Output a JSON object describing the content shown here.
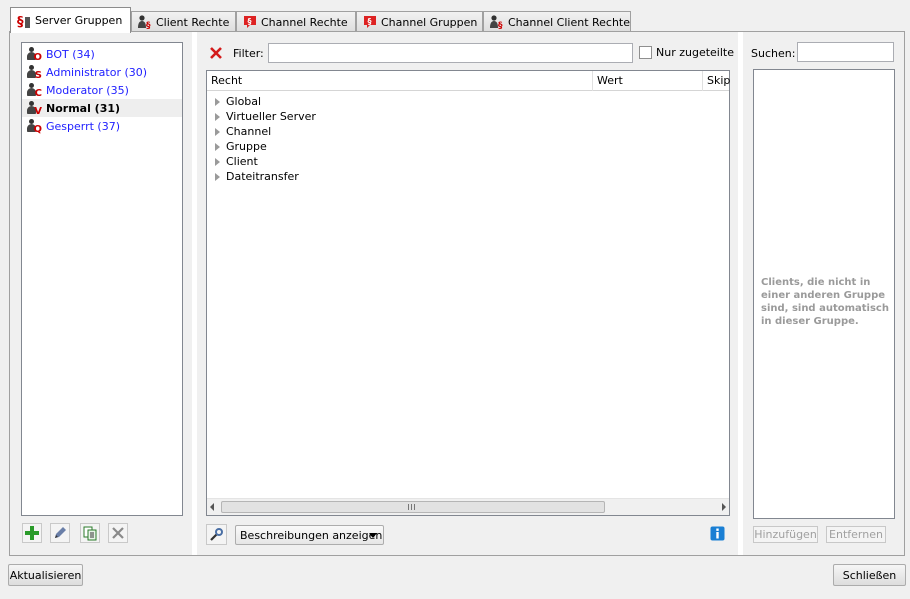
{
  "tabs": [
    {
      "label": "Server Gruppen",
      "icon": "server-group-icon",
      "active": true
    },
    {
      "label": "Client Rechte",
      "icon": "client-permission-icon",
      "active": false
    },
    {
      "label": "Channel Rechte",
      "icon": "channel-permission-icon",
      "active": false
    },
    {
      "label": "Channel Gruppen",
      "icon": "channel-group-icon",
      "active": false
    },
    {
      "label": "Channel Client Rechte",
      "icon": "channel-client-permission-icon",
      "active": false
    }
  ],
  "groups": [
    {
      "label": "BOT (34)",
      "badge": "O",
      "selected": false
    },
    {
      "label": "Administrator (30)",
      "badge": "S",
      "selected": false
    },
    {
      "label": "Moderator (35)",
      "badge": "C",
      "selected": false
    },
    {
      "label": "Normal (31)",
      "badge": "V",
      "selected": true
    },
    {
      "label": "Gesperrt (37)",
      "badge": "Q",
      "selected": false
    }
  ],
  "group_tools": [
    "add-group-icon",
    "rename-group-icon",
    "copy-group-icon",
    "delete-group-icon"
  ],
  "filter": {
    "label": "Filter:",
    "value": "",
    "only_assigned_label": "Nur zugeteilte",
    "only_assigned_checked": false
  },
  "tree": {
    "columns": [
      "Recht",
      "Wert",
      "Skip"
    ],
    "items": [
      "Global",
      "Virtueller Server",
      "Channel",
      "Gruppe",
      "Client",
      "Dateitransfer"
    ]
  },
  "descriptions_dropdown": "Beschreibungen anzeigen",
  "search": {
    "label": "Suchen:",
    "value": ""
  },
  "client_hint": "Clients, die nicht in einer anderen Gruppe sind, sind automatisch in dieser Gruppe.",
  "buttons": {
    "add": "Hinzufügen",
    "remove": "Entfernen",
    "refresh": "Aktualisieren",
    "close": "Schließen"
  },
  "colors": {
    "group_link": "#1e1eff",
    "badge_red": "#cc0000",
    "info_blue": "#1a7fd4"
  }
}
